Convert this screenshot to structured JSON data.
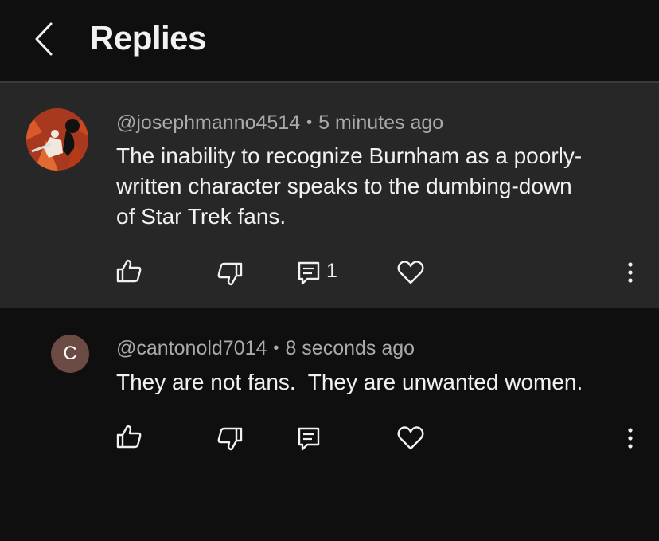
{
  "header": {
    "title": "Replies",
    "back_icon": "chevron-left-icon"
  },
  "main_comment": {
    "author": "@josephmanno4514",
    "separator": "•",
    "time": "5 minutes ago",
    "text": "The inability to recognize Burnham as a poorly-written character speaks to the dumbing-down of Star Trek fans.",
    "text_lines": [
      "The inability to recognize Burnham as a poorly-",
      "written character speaks to the dumbing-down",
      "of Star Trek fans."
    ],
    "reply_count": "1",
    "actions": [
      "like-icon",
      "dislike-icon",
      "reply-icon",
      "heart-icon",
      "more-icon"
    ]
  },
  "reply_comment": {
    "avatar_letter": "C",
    "avatar_color": "#6b4b43",
    "author": "@cantonold7014",
    "separator": "•",
    "time": "8 seconds ago",
    "text": "They are not fans.  They are unwanted women.",
    "actions": [
      "like-icon",
      "dislike-icon",
      "reply-icon",
      "heart-icon",
      "more-icon"
    ]
  },
  "colors": {
    "background": "#0f0f0f",
    "highlight": "#272727",
    "text_primary": "#f1f1f1",
    "text_secondary": "#aaaaaa"
  }
}
